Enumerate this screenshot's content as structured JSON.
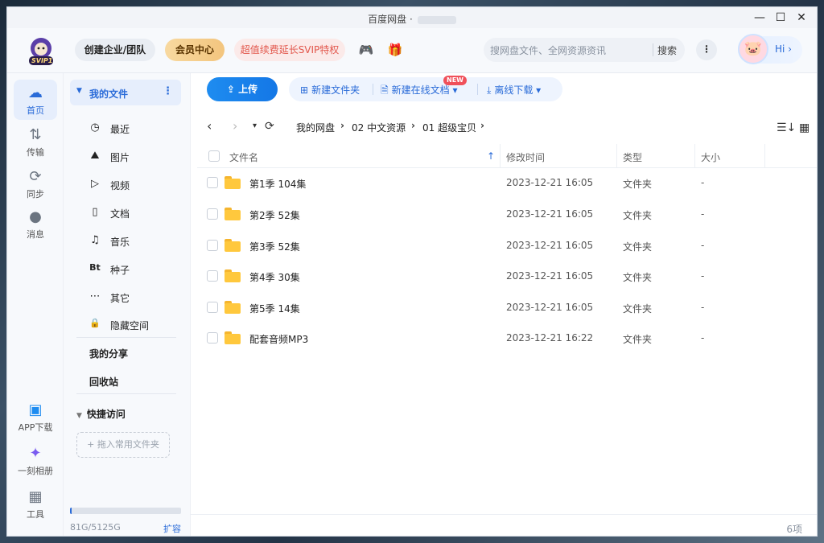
{
  "window": {
    "title": "百度网盘 ·",
    "controls": [
      "—",
      "☐",
      "✕"
    ]
  },
  "header": {
    "logo_text": "SVIP1",
    "btn_enterprise": "创建企业/团队",
    "btn_member": "会员中心",
    "btn_promo": "超值续费延长SVIP特权",
    "search_placeholder": "搜网盘文件、全网资源资讯",
    "search_button": "搜索",
    "more": "⋮",
    "greeting": "Hi ›"
  },
  "rail": [
    {
      "label": "首页",
      "icon": "home-icon",
      "glyph": "☁",
      "active": true
    },
    {
      "label": "传输",
      "icon": "transfer-icon",
      "glyph": "⇅",
      "active": false
    },
    {
      "label": "同步",
      "icon": "sync-icon",
      "glyph": "⟳",
      "active": false
    },
    {
      "label": "消息",
      "icon": "message-icon",
      "glyph": "●",
      "active": false
    },
    {
      "label": "APP下载",
      "icon": "app-download-icon",
      "glyph": "▣",
      "active": false
    },
    {
      "label": "一刻相册",
      "icon": "album-icon",
      "glyph": "✦",
      "active": false
    },
    {
      "label": "工具",
      "icon": "tools-icon",
      "glyph": "▦",
      "active": false
    }
  ],
  "sidebar": {
    "my_files": "我的文件",
    "items": [
      {
        "label": "最近",
        "icon": "clock-icon",
        "glyph": "◷"
      },
      {
        "label": "图片",
        "icon": "image-icon",
        "glyph": "⛰"
      },
      {
        "label": "视频",
        "icon": "video-icon",
        "glyph": "▷"
      },
      {
        "label": "文档",
        "icon": "document-icon",
        "glyph": "▯"
      },
      {
        "label": "音乐",
        "icon": "music-icon",
        "glyph": "♫"
      },
      {
        "label": "种子",
        "icon": "bt-icon",
        "glyph": "Bt"
      },
      {
        "label": "其它",
        "icon": "other-icon",
        "glyph": "⋯"
      },
      {
        "label": "隐藏空间",
        "icon": "lock-icon",
        "glyph": "🔒"
      }
    ],
    "my_share": "我的分享",
    "recycle": "回收站",
    "quick_access": "快捷访问",
    "drop_hint": "+ 拖入常用文件夹",
    "storage_text": "81G/5125G",
    "storage_used_ratio": 0.016,
    "expand": "扩容"
  },
  "toolbar": {
    "upload": "上传",
    "new_folder": "新建文件夹",
    "new_online_doc": "新建在线文档",
    "new_badge": "NEW",
    "offline_download": "离线下载"
  },
  "breadcrumb": [
    "我的网盘",
    "02 中文资源",
    "01 超级宝贝"
  ],
  "columns": {
    "name": "文件名",
    "modified": "修改时间",
    "type": "类型",
    "size": "大小"
  },
  "files": [
    {
      "name": "第1季 104集",
      "modified": "2023-12-21 16:05",
      "type": "文件夹",
      "size": "-"
    },
    {
      "name": "第2季 52集",
      "modified": "2023-12-21 16:05",
      "type": "文件夹",
      "size": "-"
    },
    {
      "name": "第3季 52集",
      "modified": "2023-12-21 16:05",
      "type": "文件夹",
      "size": "-"
    },
    {
      "name": "第4季 30集",
      "modified": "2023-12-21 16:05",
      "type": "文件夹",
      "size": "-"
    },
    {
      "name": "第5季 14集",
      "modified": "2023-12-21 16:05",
      "type": "文件夹",
      "size": "-"
    },
    {
      "name": "配套音频MP3",
      "modified": "2023-12-21 16:22",
      "type": "文件夹",
      "size": "-"
    }
  ],
  "footer": {
    "count": "6项"
  }
}
